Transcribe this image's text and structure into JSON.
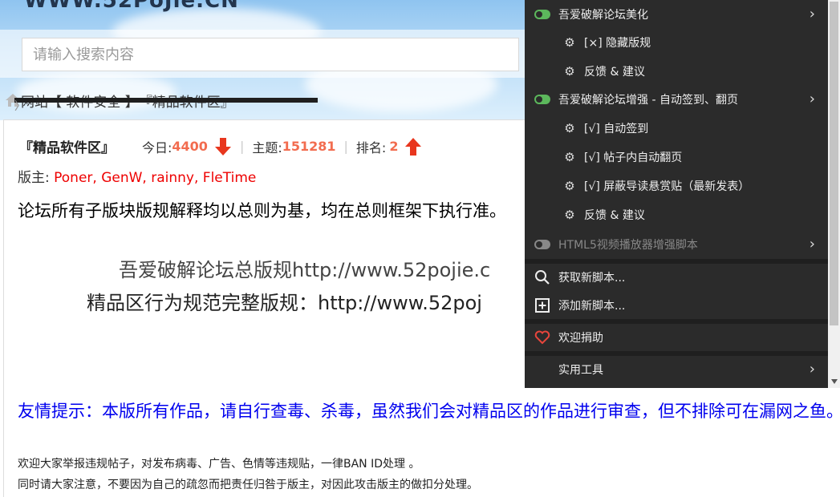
{
  "site": {
    "logo": "WWW.52PoJie.CN"
  },
  "search": {
    "placeholder": "请输入搜索内容"
  },
  "breadcrumb": {
    "items": [
      "网站",
      "【 软件安全 】",
      "『精品软件区』"
    ]
  },
  "forum": {
    "name": "『精品软件区』",
    "today_label": "今日:",
    "today_value": "4400",
    "topics_label": "主题:",
    "topics_value": "151281",
    "rank_label": "排名:",
    "rank_value": "2",
    "mods_label": "版主:",
    "mods": "Poner, GenW, rainny, FleTime",
    "rules_text": "论坛所有子版块版规解释均以总则为基，均在总则框架下执行准。",
    "rules_link1": "吾爱破解论坛总版规http://www.52pojie.c",
    "rules_link2": "精品区行为规范完整版规：http://www.52poj",
    "tip": "友情提示：本版所有作品，请自行查毒、杀毒，虽然我们会对精品区的作品进行审查，但不排除可在漏网之鱼。",
    "notice1": "欢迎大家举报违规帖子，对发布病毒、广告、色情等违规贴，一律BAN ID处理 。",
    "notice2": "同时请大家注意，不要因为自己的疏忽而把责任归咎于版主，对因此攻击版主的做扣分处理。"
  },
  "menu": {
    "script1": "吾爱破解论坛美化",
    "script1_cmd1": "[×] 隐藏版规",
    "script1_cmd2": "反馈 & 建议",
    "script2": "吾爱破解论坛增强 - 自动签到、翻页",
    "script2_cmd1": "[√] 自动签到",
    "script2_cmd2": "[√] 帖子内自动翻页",
    "script2_cmd3": "[√] 屏蔽导读悬赏贴（最新发表）",
    "script2_cmd4": "反馈 & 建议",
    "script3": "HTML5视频播放器增强脚本",
    "get_new": "获取新脚本...",
    "add_new": "添加新脚本...",
    "donate": "欢迎捐助",
    "tools": "实用工具"
  },
  "colors": {
    "accent_green": "#5cb85c",
    "menu_bg": "#2b2b2b",
    "number_orange": "#f26c4f",
    "tip_blue": "#0000ee"
  }
}
